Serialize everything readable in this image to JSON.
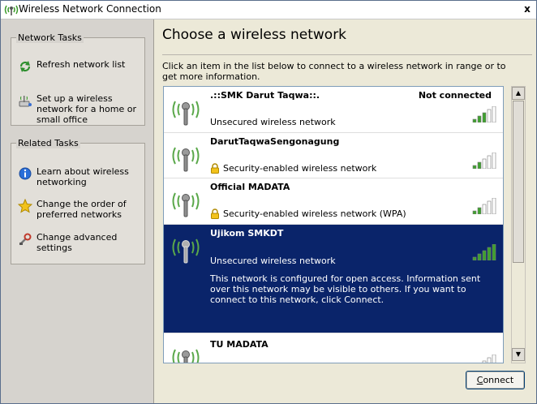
{
  "window": {
    "title": "Wireless Network Connection",
    "close_glyph": "x"
  },
  "sidebar": {
    "network_tasks": {
      "header": "Network Tasks",
      "items": [
        {
          "label": "Refresh network list",
          "icon": "refresh-icon"
        },
        {
          "label": "Set up a wireless network for a home or small office",
          "icon": "setup-network-icon"
        }
      ]
    },
    "related_tasks": {
      "header": "Related Tasks",
      "items": [
        {
          "label": "Learn about wireless networking",
          "icon": "info-icon"
        },
        {
          "label": "Change the order of preferred networks",
          "icon": "star-icon"
        },
        {
          "label": "Change advanced settings",
          "icon": "settings-icon"
        }
      ]
    }
  },
  "main": {
    "heading": "Choose a wireless network",
    "instructions": "Click an item in the list below to connect to a wireless network in range or to get more information.",
    "networks": [
      {
        "ssid": ".::SMK Darut Taqwa::.",
        "status": "Not connected",
        "security": "Unsecured wireless network",
        "secured": false,
        "signal": 3,
        "selected": false
      },
      {
        "ssid": "DarutTaqwaSengonagung",
        "status": "",
        "security": "Security-enabled wireless network",
        "secured": true,
        "signal": 2,
        "selected": false
      },
      {
        "ssid": "Official MADATA",
        "status": "",
        "security": "Security-enabled wireless network (WPA)",
        "secured": true,
        "signal": 2,
        "selected": false
      },
      {
        "ssid": "Ujikom SMKDT",
        "status": "",
        "security": "Unsecured wireless network",
        "secured": false,
        "signal": 5,
        "selected": true,
        "description": "This network is configured for open access. Information sent over this network may be visible to others. If you want to connect to this network, click Connect."
      },
      {
        "ssid": "TU MADATA",
        "status": "",
        "security": "",
        "secured": false,
        "signal": 2,
        "selected": false
      }
    ],
    "connect_button": {
      "label_underlined": "C",
      "label_rest": "onnect"
    }
  },
  "colors": {
    "selection": "#0a246a",
    "signal_on": "#3ea12e",
    "signal_off": "#ffffff",
    "antenna": "#5aa84a"
  }
}
